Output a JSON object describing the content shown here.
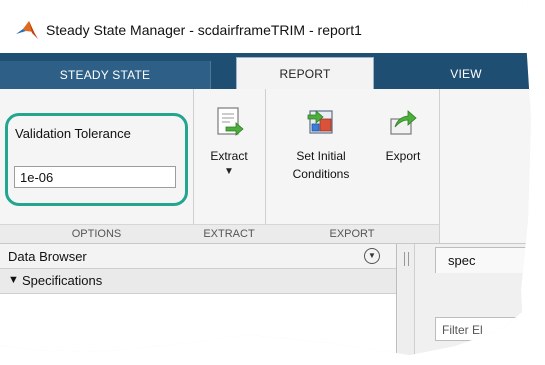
{
  "window": {
    "title": "Steady State Manager - scdairframeTRIM - report1"
  },
  "tabs": [
    {
      "label": "STEADY STATE"
    },
    {
      "label": "REPORT"
    },
    {
      "label": "VIEW"
    }
  ],
  "ribbon": {
    "options": {
      "section_label": "OPTIONS",
      "tolerance_label": "Validation Tolerance",
      "tolerance_value": "1e-06"
    },
    "extract": {
      "section_label": "EXTRACT",
      "button_label": "Extract",
      "caret": "▼"
    },
    "export": {
      "section_label": "EXPORT",
      "set_ic_line1": "Set Initial",
      "set_ic_line2": "Conditions",
      "export_label": "Export"
    }
  },
  "data_browser": {
    "title": "Data Browser",
    "menu_icon": "▼",
    "specifications_label": "Specifications",
    "arrow": "▼"
  },
  "document": {
    "tab_label": "spec",
    "filter_placeholder": "Filter El"
  },
  "colors": {
    "tab_strip": "#1f4e73",
    "highlight": "#23a58f"
  }
}
